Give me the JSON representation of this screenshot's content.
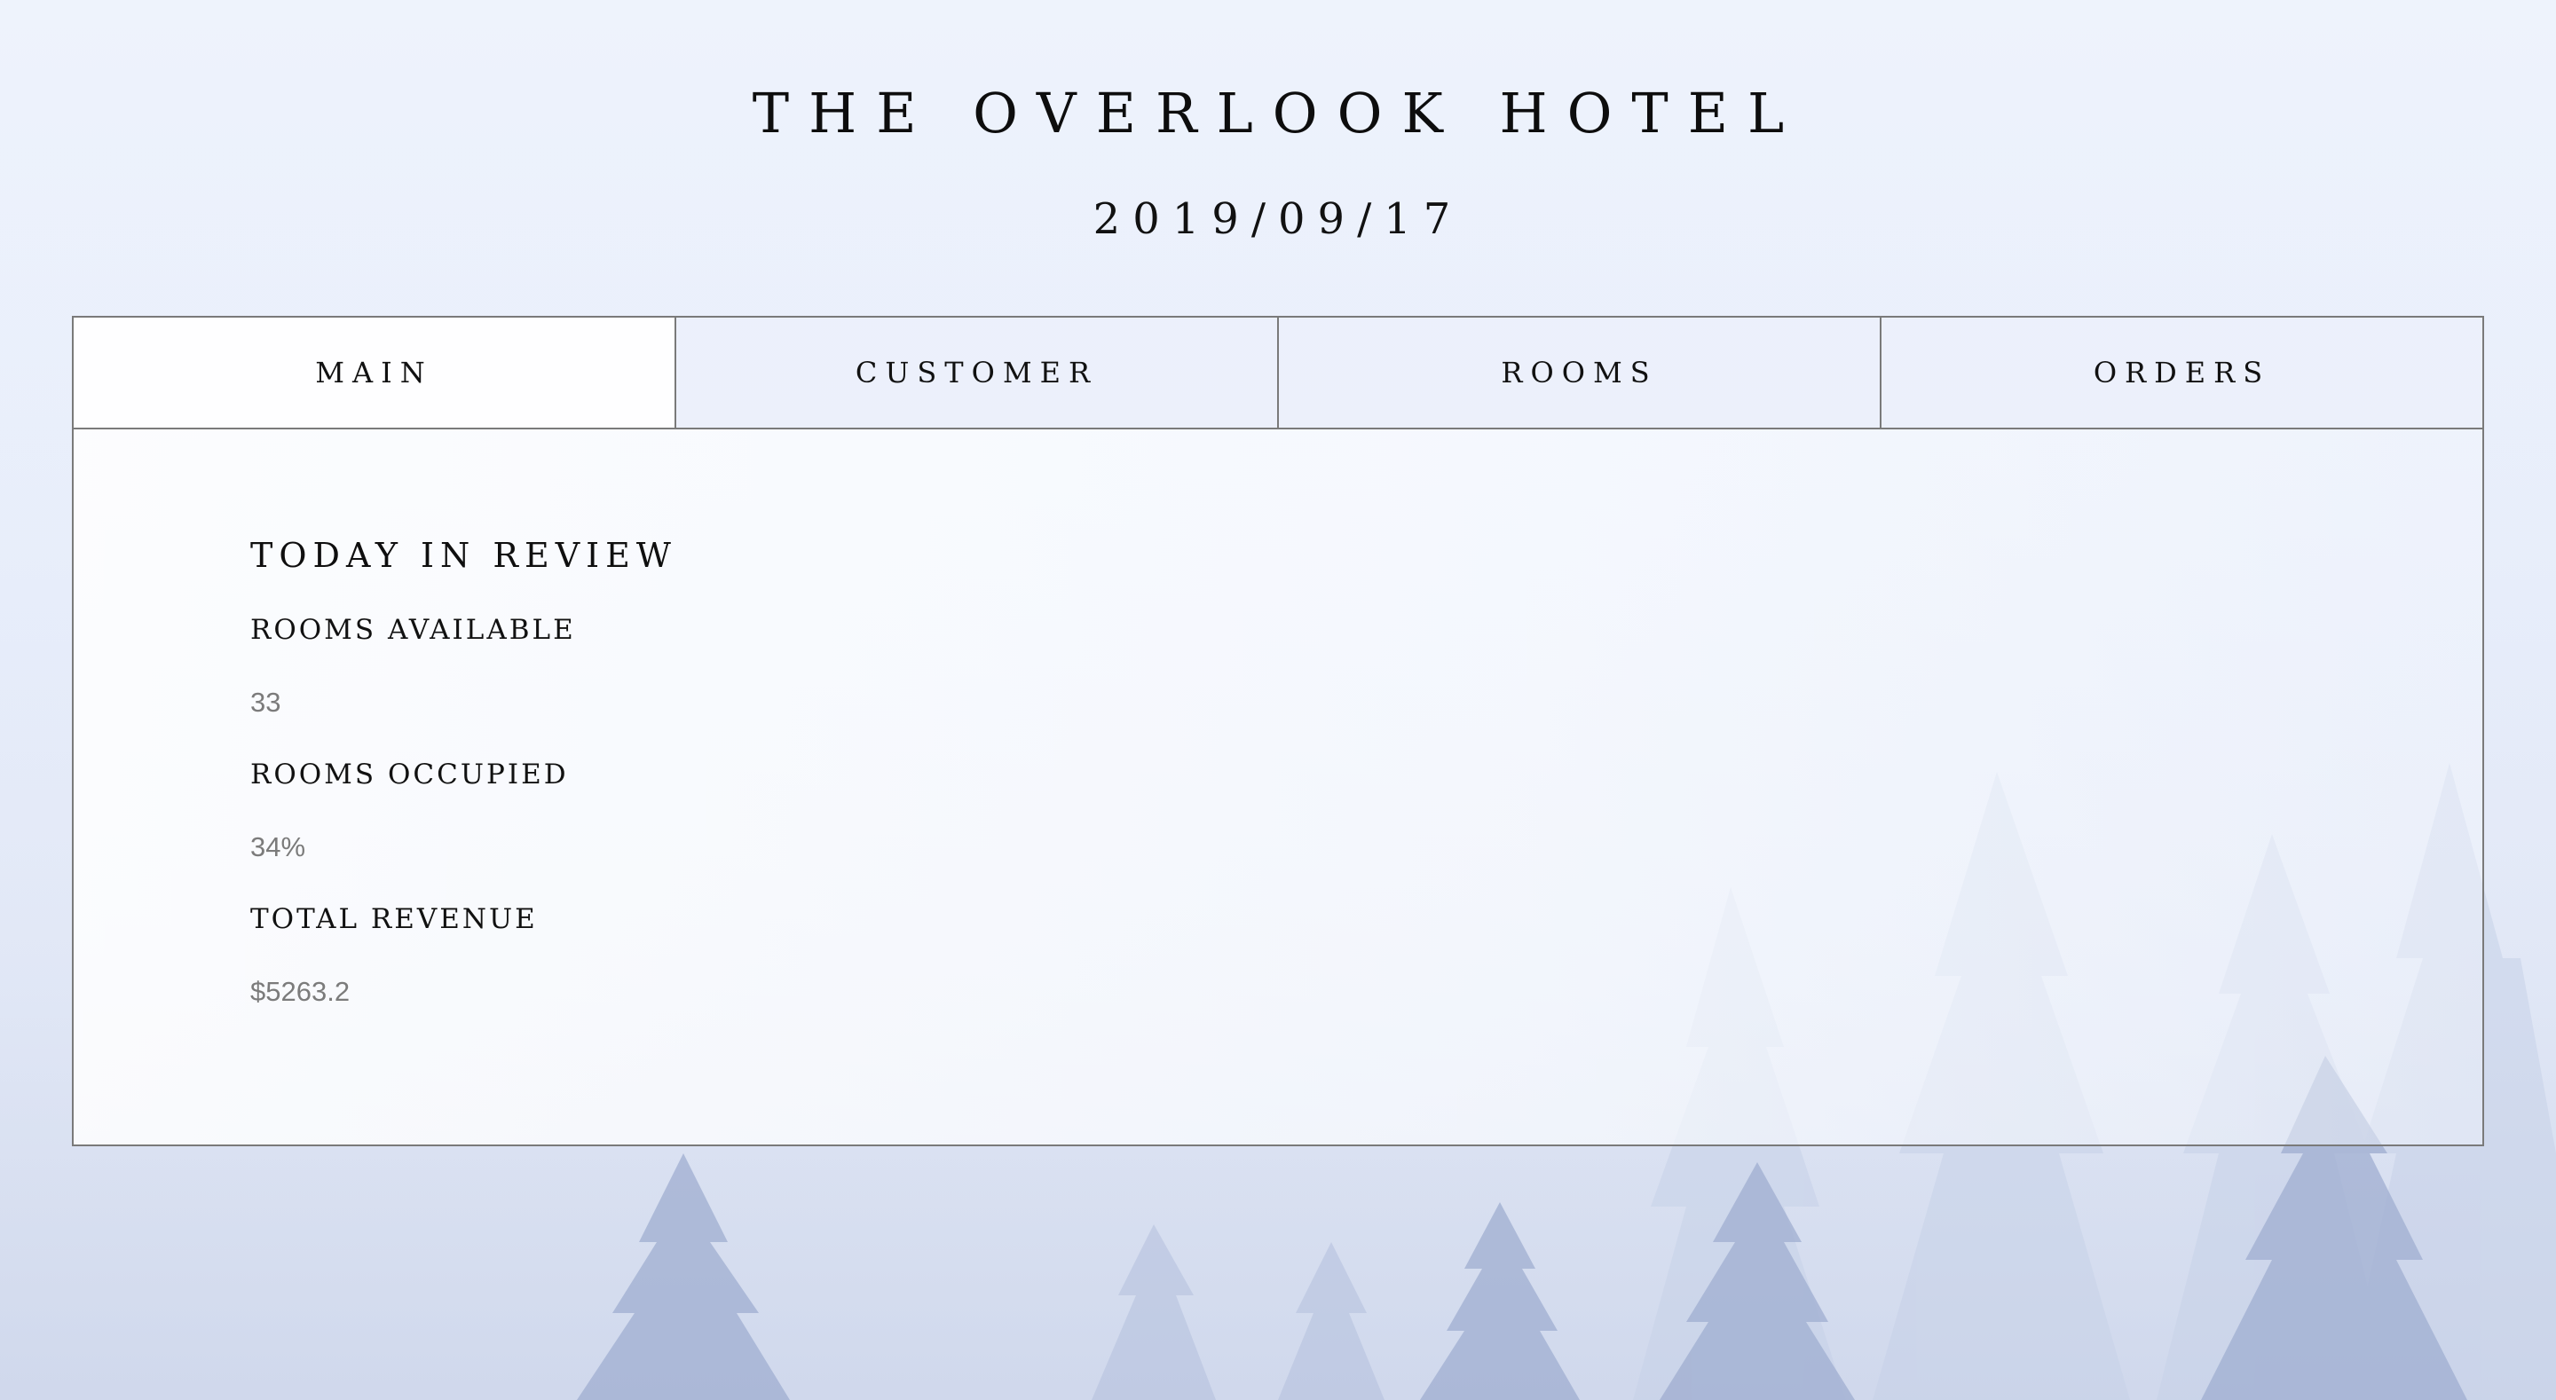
{
  "header": {
    "title": "THE OVERLOOK HOTEL",
    "date": "2019/09/17"
  },
  "tabs": [
    {
      "label": "MAIN",
      "active": true
    },
    {
      "label": "CUSTOMER",
      "active": false
    },
    {
      "label": "ROOMS",
      "active": false
    },
    {
      "label": "ORDERS",
      "active": false
    }
  ],
  "review": {
    "title": "TODAY IN REVIEW",
    "stats": [
      {
        "label": "ROOMS AVAILABLE",
        "value": "33"
      },
      {
        "label": "ROOMS OCCUPIED",
        "value": "34%"
      },
      {
        "label": "TOTAL REVENUE",
        "value": "$5263.2"
      }
    ]
  },
  "colors": {
    "border": "#7a7a7a",
    "muted_value": "#7b7b7b",
    "text": "#111111",
    "background_sky": "#e8eefb"
  }
}
